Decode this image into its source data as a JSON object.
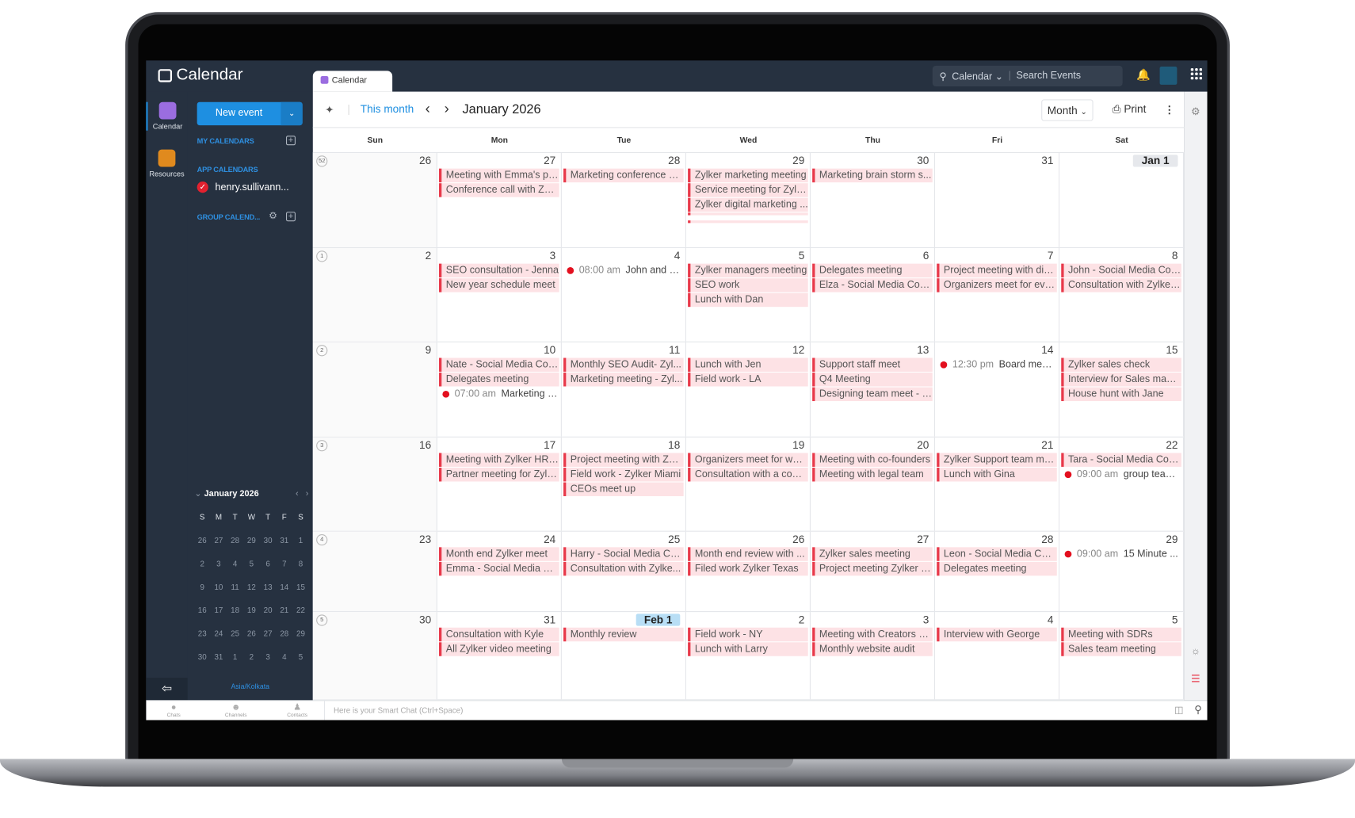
{
  "app": {
    "title": "Calendar",
    "tab": "Calendar"
  },
  "topbar": {
    "search_scope": "Calendar",
    "search_placeholder": "Search Events"
  },
  "rail": [
    {
      "label": "Calendar",
      "color": "#9b6de0",
      "active": true
    },
    {
      "label": "Resources",
      "color": "#e08a1e",
      "active": false
    }
  ],
  "sidebar": {
    "new_event": "New event",
    "my_calendars": "MY CALENDARS",
    "app_calendars": "APP CALENDARS",
    "calendar_item": "henry.sullivann...",
    "calendar_item_color": "#e3212f",
    "group_calendars": "GROUP CALEND...",
    "timezone": "Asia/Kolkata"
  },
  "mini_calendar": {
    "title": "January 2026",
    "dow": [
      "S",
      "M",
      "T",
      "W",
      "T",
      "F",
      "S"
    ],
    "weeks": [
      [
        "26",
        "27",
        "28",
        "29",
        "30",
        "31",
        "1"
      ],
      [
        "2",
        "3",
        "4",
        "5",
        "6",
        "7",
        "8"
      ],
      [
        "9",
        "10",
        "11",
        "12",
        "13",
        "14",
        "15"
      ],
      [
        "16",
        "17",
        "18",
        "19",
        "20",
        "21",
        "22"
      ],
      [
        "23",
        "24",
        "25",
        "26",
        "27",
        "28",
        "29"
      ],
      [
        "30",
        "31",
        "1",
        "2",
        "3",
        "4",
        "5"
      ]
    ]
  },
  "toolbar": {
    "this_month": "This month",
    "title": "January 2026",
    "view": "Month",
    "print": "Print"
  },
  "day_headers": [
    "Sun",
    "Mon",
    "Tue",
    "Wed",
    "Thu",
    "Fri",
    "Sat"
  ],
  "colors": {
    "accent": "#1e8fe1",
    "event_bg": "#fde2e5",
    "event_bar": "#e8394a",
    "sidebar": "#263140"
  },
  "weeks": [
    {
      "week": "52",
      "days": [
        {
          "num": "26",
          "events": []
        },
        {
          "num": "27",
          "events": [
            {
              "title": "Meeting with Emma's pa..."
            },
            {
              "title": "Conference call with Zyl..."
            }
          ]
        },
        {
          "num": "28",
          "events": [
            {
              "title": "Marketing conference ki..."
            }
          ]
        },
        {
          "num": "29",
          "events": [
            {
              "title": "Zylker marketing meeting"
            },
            {
              "title": "Service meeting for Zylk..."
            },
            {
              "title": "Zylker digital marketing ..."
            }
          ],
          "more_strips": 2
        },
        {
          "num": "30",
          "events": [
            {
              "title": "Marketing brain storm s..."
            }
          ]
        },
        {
          "num": "31",
          "events": []
        },
        {
          "num": "Jan 1",
          "style": "badge",
          "events": []
        }
      ]
    },
    {
      "week": "1",
      "days": [
        {
          "num": "2",
          "events": []
        },
        {
          "num": "3",
          "events": [
            {
              "title": "SEO consultation - Jenna"
            },
            {
              "title": "New year schedule meet"
            }
          ]
        },
        {
          "num": "4",
          "events": [
            {
              "time": "08:00 am",
              "title": "John and zyl..."
            }
          ]
        },
        {
          "num": "5",
          "events": [
            {
              "title": "Zylker managers meeting"
            },
            {
              "title": "SEO work"
            },
            {
              "title": "Lunch with Dan"
            }
          ]
        },
        {
          "num": "6",
          "events": [
            {
              "title": "Delegates meeting"
            },
            {
              "title": "Elza - Social Media Cons..."
            }
          ]
        },
        {
          "num": "7",
          "events": [
            {
              "title": "Project meeting with dig..."
            },
            {
              "title": "Organizers meet for event"
            }
          ]
        },
        {
          "num": "8",
          "events": [
            {
              "title": "John - Social Media Con..."
            },
            {
              "title": "Consultation with Zylker..."
            }
          ]
        }
      ]
    },
    {
      "week": "2",
      "days": [
        {
          "num": "9",
          "events": []
        },
        {
          "num": "10",
          "events": [
            {
              "title": "Nate - Social Media Con..."
            },
            {
              "title": "Delegates meeting"
            },
            {
              "time": "07:00 am",
              "title": "Marketing c..."
            }
          ]
        },
        {
          "num": "11",
          "events": [
            {
              "title": "Monthly SEO Audit- Zyl..."
            },
            {
              "title": "Marketing meeting - Zyl..."
            }
          ]
        },
        {
          "num": "12",
          "events": [
            {
              "title": "Lunch with Jen"
            },
            {
              "title": "Field work - LA"
            }
          ]
        },
        {
          "num": "13",
          "events": [
            {
              "title": "Support staff meet"
            },
            {
              "title": "Q4 Meeting"
            },
            {
              "title": "Designing team meet - Z..."
            }
          ]
        },
        {
          "num": "14",
          "events": [
            {
              "time": "12:30 pm",
              "title": "Board mem..."
            }
          ]
        },
        {
          "num": "15",
          "events": [
            {
              "title": "Zylker sales check"
            },
            {
              "title": "Interview for Sales mana..."
            },
            {
              "title": "House hunt with Jane"
            }
          ]
        }
      ]
    },
    {
      "week": "3",
      "days": [
        {
          "num": "16",
          "events": []
        },
        {
          "num": "17",
          "events": [
            {
              "title": "Meeting with Zylker HR ..."
            },
            {
              "title": "Partner meeting for Zylk..."
            }
          ]
        },
        {
          "num": "18",
          "events": [
            {
              "title": "Project meeting with Zyl..."
            },
            {
              "title": "Field work - Zylker Miami"
            },
            {
              "title": "CEOs meet up"
            }
          ]
        },
        {
          "num": "19",
          "events": [
            {
              "title": "Organizers meet for wor..."
            },
            {
              "title": "Consultation with a com..."
            }
          ]
        },
        {
          "num": "20",
          "events": [
            {
              "title": "Meeting with co-founders"
            },
            {
              "title": "Meeting with legal team"
            }
          ]
        },
        {
          "num": "21",
          "events": [
            {
              "title": "Zylker Support team me..."
            },
            {
              "title": "Lunch with Gina"
            }
          ]
        },
        {
          "num": "22",
          "events": [
            {
              "title": "Tara - Social Media Cons..."
            },
            {
              "time": "09:00 am",
              "title": "group team ..."
            }
          ]
        }
      ]
    },
    {
      "week": "4",
      "days": [
        {
          "num": "23",
          "events": []
        },
        {
          "num": "24",
          "events": [
            {
              "title": "Month end Zylker meet"
            },
            {
              "title": "Emma - Social Media Co..."
            }
          ]
        },
        {
          "num": "25",
          "events": [
            {
              "title": "Harry - Social Media Co..."
            },
            {
              "title": "Consultation with Zylke..."
            }
          ]
        },
        {
          "num": "26",
          "events": [
            {
              "title": "Month end review with ..."
            },
            {
              "title": "Filed work Zylker Texas"
            }
          ]
        },
        {
          "num": "27",
          "events": [
            {
              "title": "Zylker sales meeting"
            },
            {
              "title": "Project meeting Zylker F..."
            }
          ]
        },
        {
          "num": "28",
          "events": [
            {
              "title": "Leon - Social Media Con..."
            },
            {
              "title": "Delegates meeting"
            }
          ]
        },
        {
          "num": "29",
          "events": [
            {
              "time": "09:00 am",
              "title": "15 Minute ..."
            }
          ]
        }
      ]
    },
    {
      "week": "5",
      "days": [
        {
          "num": "30",
          "events": []
        },
        {
          "num": "31",
          "events": [
            {
              "title": "Consultation with Kyle"
            },
            {
              "title": "All Zylker video meeting"
            }
          ]
        },
        {
          "num": "Feb 1",
          "style": "feb",
          "events": [
            {
              "title": "Monthly review"
            }
          ]
        },
        {
          "num": "2",
          "events": [
            {
              "title": "Field work - NY"
            },
            {
              "title": "Lunch with Larry"
            }
          ]
        },
        {
          "num": "3",
          "events": [
            {
              "title": "Meeting with Creators o..."
            },
            {
              "title": "Monthly website audit"
            }
          ]
        },
        {
          "num": "4",
          "events": [
            {
              "title": "Interview with George"
            }
          ]
        },
        {
          "num": "5",
          "events": [
            {
              "title": "Meeting with SDRs"
            },
            {
              "title": "Sales team meeting"
            }
          ]
        }
      ]
    }
  ],
  "bottom": {
    "chats": "Chats",
    "channels": "Channels",
    "contacts": "Contacts",
    "smart_chat": "Here is your Smart Chat (Ctrl+Space)"
  }
}
